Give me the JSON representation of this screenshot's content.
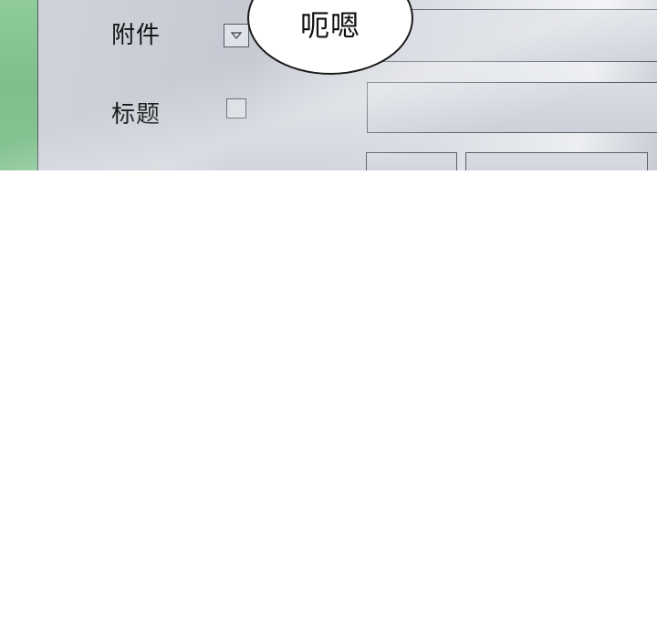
{
  "form": {
    "attachment_label": "附件",
    "title_label": "标题"
  },
  "speech_bubble": {
    "text": "呃嗯"
  },
  "icons": {
    "dropdown": "triangle-down-icon",
    "checkbox": "empty-checkbox"
  },
  "colors": {
    "accent_green": "#86c494",
    "panel_gray": "#cdd1d9",
    "border_dark": "#555a62"
  }
}
